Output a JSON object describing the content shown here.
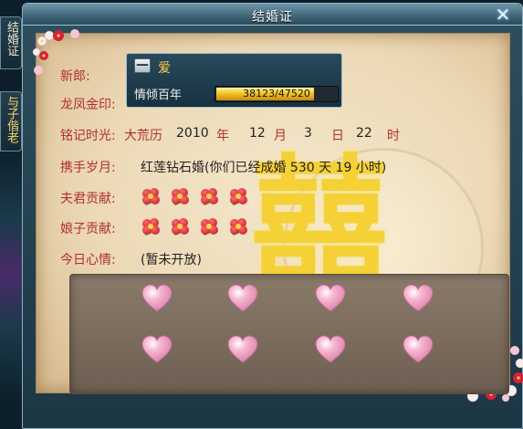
{
  "side_tabs": [
    {
      "label": "结婚证"
    },
    {
      "label": "与子偕老"
    }
  ],
  "window": {
    "title": "结婚证",
    "close_label": "✕"
  },
  "certificate": {
    "groom_label": "新郎:",
    "seal_label": "龙凤金印:",
    "date_label": "铭记时光:",
    "date": {
      "era": "大荒历",
      "year": "2010",
      "year_unit": "年",
      "month": "12",
      "month_unit": "月",
      "day": "3",
      "day_unit": "日",
      "hour": "22",
      "hour_unit": "时"
    },
    "duration_label": "携手岁月:",
    "duration_value": "红莲钻石婚(你们已经成婚 530 天 19 小时)",
    "husband_label": "夫君贡献:",
    "wife_label": "娘子贡献:",
    "mood_label": "今日心情:",
    "mood_value": "(暂未开放)",
    "watermark": "囍"
  },
  "seal_popup": {
    "toggle_label": "—",
    "name": "爱",
    "title": "情倾百年",
    "progress_text": "38123/47520",
    "progress_fraction": 0.8022
  },
  "contributions": {
    "husband_count": 4,
    "wife_count": 4,
    "icon": "red-flower-icon"
  },
  "hearts": {
    "count": 8,
    "icon": "heart-icon",
    "color": "#f7b7d2"
  },
  "colors": {
    "label_red": "#b03030",
    "seal_gold": "#ffd34a",
    "watermark_gold": "#f5cd28"
  }
}
